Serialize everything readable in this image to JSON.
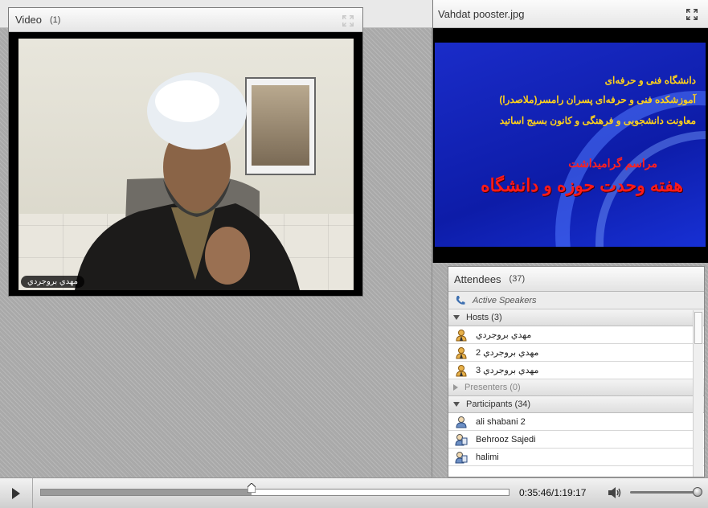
{
  "video_pod": {
    "title": "Video",
    "count": "(1)",
    "name_tag": "مهدي بروجردي"
  },
  "share_pod": {
    "title": "Vahdat pooster.jpg",
    "slide": {
      "line1": "دانشگاه فنی و حرفه‌ای",
      "line2": "آموزشکده فنی و حرفه‌ای پسران رامسر(ملاصدرا)",
      "line3": "معاونت دانشجویی و فرهنگی و کانون بسیج اساتید",
      "title_small": "مراسم گرامیداشت",
      "title_large": "هفته وحدت حوزه و دانشگاه"
    }
  },
  "attendees": {
    "title": "Attendees",
    "count": "(37)",
    "active_speakers": "Active Speakers",
    "hosts": {
      "label": "Hosts (3)",
      "rows": [
        {
          "name": "مهدي بروجردي"
        },
        {
          "name": "مهدي بروجردي 2"
        },
        {
          "name": "مهدي بروجردي 3"
        }
      ]
    },
    "presenters": {
      "label": "Presenters (0)"
    },
    "participants": {
      "label": "Participants (34)",
      "rows": [
        {
          "name": "ali shabani 2"
        },
        {
          "name": "Behrooz Sajedi"
        },
        {
          "name": "halimi"
        }
      ]
    }
  },
  "playback": {
    "time": "0:35:46/1:19:17",
    "progress_fraction": 0.451,
    "volume_fraction": 0.95
  },
  "colors": {
    "slide_bg": "#1a2cc9",
    "slide_text": "#ffd21a",
    "slide_title": "#ff1a1a"
  }
}
